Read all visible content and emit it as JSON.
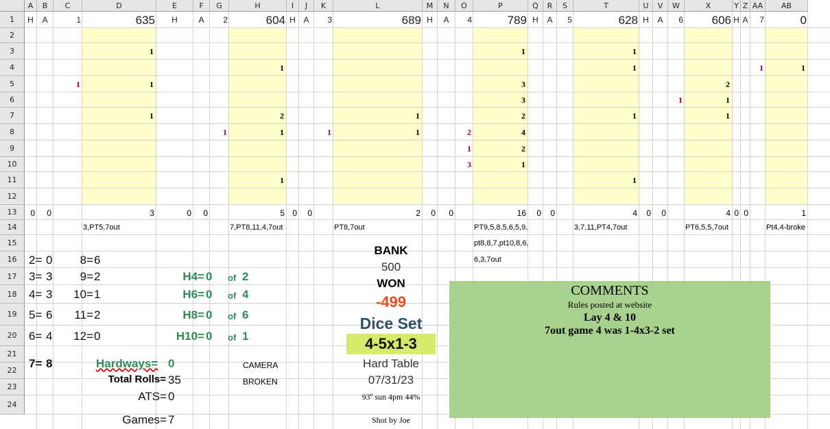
{
  "columns": [
    "A",
    "B",
    "C",
    "D",
    "E",
    "F",
    "G",
    "H",
    "I",
    "J",
    "K",
    "L",
    "M",
    "N",
    "O",
    "P",
    "Q",
    "R",
    "S",
    "T",
    "U",
    "V",
    "W",
    "X",
    "Y",
    "Z",
    "AA",
    "AB"
  ],
  "rows": [
    "1",
    "2",
    "3",
    "4",
    "5",
    "6",
    "7",
    "8",
    "9",
    "10",
    "11",
    "12",
    "13",
    "14",
    "15",
    "16",
    "17",
    "18",
    "19",
    "20",
    "21",
    "22",
    "23",
    "24"
  ],
  "header_row": {
    "A": "H",
    "B": "A",
    "C": "1",
    "D": "635",
    "E": "H",
    "F": "A",
    "G": "2",
    "H": "604",
    "I": "H",
    "J": "A",
    "K": "3",
    "L": "689",
    "M": "H",
    "N": "A",
    "O": "4",
    "P": "789",
    "Q": "H",
    "R": "A",
    "S": "5",
    "T": "628",
    "U": "H",
    "V": "A",
    "W": "6",
    "X": "606",
    "Y": "H",
    "Z": "A",
    "AA": "7",
    "AB": "0"
  },
  "roll_counts": {
    "D3": "1",
    "D5": "1",
    "D7": "1",
    "H4": "1",
    "H7": "2",
    "H8": "1",
    "H11": "1",
    "L7": "1",
    "L8": "1",
    "P3": "1",
    "P5": "3",
    "P6": "3",
    "P7": "2",
    "P8": "4",
    "P9": "2",
    "P10": "1",
    "T3": "1",
    "T4": "1",
    "T7": "1",
    "T11": "1",
    "X5": "2",
    "X6": "1",
    "X7": "1",
    "AB4": "1"
  },
  "hard_marks": {
    "C5": "1",
    "G8": "1",
    "K8": "1",
    "O8": "2",
    "O9": "1",
    "O10": "3",
    "W6": "1",
    "AA4": "1"
  },
  "totals_row13": {
    "A": "0",
    "B": "0",
    "D": "3",
    "E": "0",
    "F": "0",
    "H": "5",
    "I": "0",
    "J": "0",
    "L": "2",
    "M": "0",
    "N": "0",
    "P": "16",
    "Q": "0",
    "R": "0",
    "T": "4",
    "U": "0",
    "V": "0",
    "X": "4",
    "Y": "0",
    "Z": "0",
    "AB": "1"
  },
  "game_notes": {
    "D14": "3,PT5,7out",
    "H14": "7,PT8,11,4,7out",
    "L14": "PT8,7out",
    "P14": "PT9,5,8,5,6,5,9,",
    "P15": "pt8,8,7,pt10,8,6,",
    "P16": "6,3,7out",
    "T14": "3,7,11,PT4,7out",
    "X14": "PT6,5,5,7out",
    "AB14": "Pt4,4-broke"
  },
  "roll_distribution": [
    {
      "left": "2=",
      "lv": "0",
      "right": "8=",
      "rv": "6"
    },
    {
      "left": "3=",
      "lv": "3",
      "right": "9=",
      "rv": "2"
    },
    {
      "left": "4=",
      "lv": "3",
      "right": "10=",
      "rv": "1"
    },
    {
      "left": "5=",
      "lv": "6",
      "right": "11=",
      "rv": "2"
    },
    {
      "left": "6=",
      "lv": "4",
      "right": "12=",
      "rv": "0"
    }
  ],
  "sevens": {
    "label": "7=",
    "value": "8"
  },
  "hardways_stats": [
    {
      "label": "H4=",
      "value": "0",
      "of": "of",
      "total": "2"
    },
    {
      "label": "H6=",
      "value": "0",
      "of": "of",
      "total": "4"
    },
    {
      "label": "H8=",
      "value": "0",
      "of": "of",
      "total": "6"
    },
    {
      "label": "H10=",
      "value": "0",
      "of": "of",
      "total": "1"
    }
  ],
  "hardways_total": {
    "label": "Hardways=",
    "value": "0"
  },
  "total_rolls": {
    "label": "Total Rolls=",
    "value": "35"
  },
  "ats": {
    "label": "ATS=",
    "value": "0"
  },
  "games": {
    "label": "Games=",
    "value": "7"
  },
  "camera_note": {
    "line1": "CAMERA",
    "line2": "BROKEN"
  },
  "bank": {
    "label": "BANK",
    "value": "500"
  },
  "won": {
    "label": "WON",
    "value": "-499",
    "color": "#ee4b1d"
  },
  "dice_set": {
    "label": "Dice Set",
    "value": "4-5x1-3",
    "label_color": "#2f4f66",
    "value_bg": "#d4ea6b"
  },
  "table_type": "Hard Table",
  "date": "07/31/23",
  "weather": "93º sun 4pm 44%",
  "shooter": "Shot by Joe",
  "comments": {
    "title": "COMMENTS",
    "line1": "Rules posted at website",
    "line2": "Lay 4 & 10",
    "line3": "7out game 4 was 1-4x3-2 set",
    "bg": "#a9d18e"
  }
}
